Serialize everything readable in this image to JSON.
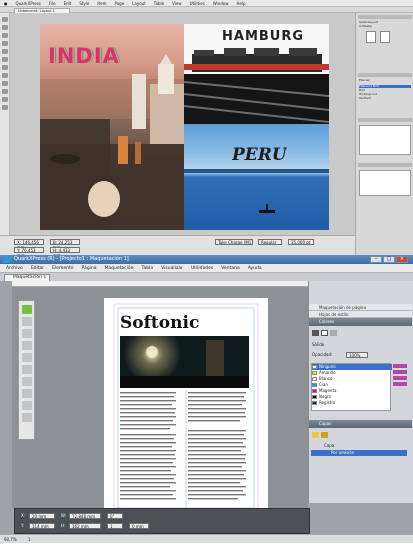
{
  "top_window": {
    "menubar": [
      "QuarkXPress",
      "File",
      "Edit",
      "Style",
      "Item",
      "Page",
      "Layout",
      "Table",
      "View",
      "Utilities",
      "Window",
      "Help"
    ],
    "tab_label": "Unbenannt: Layout 1",
    "page_titles": {
      "india": "INDIA",
      "hamburg": "HAMBURG",
      "peru": "PERU"
    },
    "right_panel_rows": [
      "Seitenlayout",
      "A-Master",
      "Ebenen",
      "Titel und Bild",
      "Bild",
      "Hintergrund",
      "Textfeld"
    ],
    "measure_fields": [
      "X: 146,456 mm",
      "Y: 76,453 mm",
      "B: 24,253 mm",
      "H: 4,433 mm",
      "Take Charge (M1)",
      "Regular",
      "35,000 pt"
    ]
  },
  "bottom_window": {
    "title": "QuarkXPress (R) - [Projecto1 : Maquetación 1]",
    "window_controls": [
      "–",
      "□",
      "×"
    ],
    "menubar": [
      "Archivo",
      "Editar",
      "Elemento",
      "Página",
      "Maquetación",
      "Tabla",
      "Visualizar",
      "Utilidades",
      "Ventana",
      "Ayuda"
    ],
    "tab_label": "Maquetación 1",
    "page_heading": "Softonic",
    "body_text": "Lorem ipsum dolor sit amet consectetur adipiscing elit sed do eiusmod tempor incididunt ut labore et dolore magna aliqua",
    "panels": {
      "page_layout": "Maquetación de página",
      "style_sheets": "Hojas de estilo",
      "colors": "Colores",
      "color_mode": "Sólido",
      "opacity_label": "Opacidad:",
      "opacity_value": "100%",
      "layers": "Capas",
      "layer_name": "Capa",
      "layer_default": "Por omisión"
    },
    "swatches": [
      {
        "name": "Ninguno",
        "color": "#ffffff",
        "selected": true
      },
      {
        "name": "Amarillo",
        "color": "#f5e400"
      },
      {
        "name": "Blanco",
        "color": "#ffffff"
      },
      {
        "name": "Cian",
        "color": "#00a9e6"
      },
      {
        "name": "Magenta",
        "color": "#e0007a"
      },
      {
        "name": "Negro",
        "color": "#111111"
      },
      {
        "name": "Registro",
        "color": "#222222"
      }
    ],
    "measure": {
      "x_label": "X:",
      "x_value": "20 mm",
      "y_label": "Y:",
      "y_value": "114 mm",
      "w_label": "W:",
      "w_value": "72,848 mm",
      "h_label": "H:",
      "h_value": "162 mm",
      "angle_value": "0°",
      "cols_value": "1",
      "inset_value": "0 mm"
    },
    "status": {
      "zoom": "90,7%",
      "page": "1"
    }
  }
}
